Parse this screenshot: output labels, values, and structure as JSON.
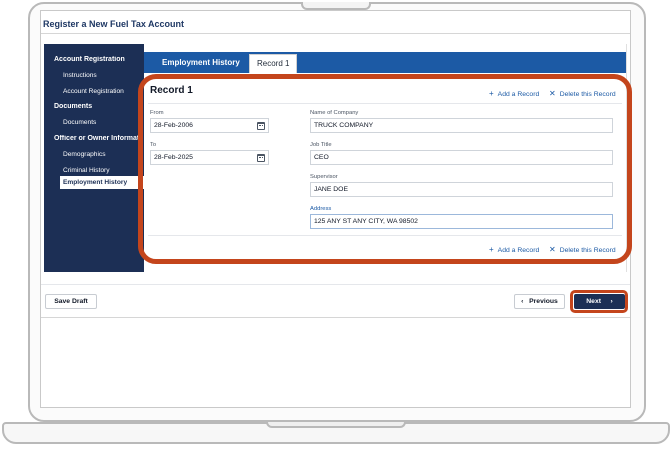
{
  "page": {
    "title": "Register a New Fuel Tax Account"
  },
  "sidebar": {
    "items": [
      {
        "label": "Account Registration",
        "kind": "section"
      },
      {
        "label": "Instructions",
        "kind": "sub"
      },
      {
        "label": "Account Registration",
        "kind": "sub"
      },
      {
        "label": "Documents",
        "kind": "section"
      },
      {
        "label": "Documents",
        "kind": "sub"
      },
      {
        "label": "Officer or Owner Informat",
        "kind": "section"
      },
      {
        "label": "Demographics",
        "kind": "sub"
      },
      {
        "label": "Criminal History",
        "kind": "sub"
      },
      {
        "label": "Employment History",
        "kind": "sub",
        "active": true
      }
    ]
  },
  "tabs": [
    {
      "label": "Employment History",
      "active": false
    },
    {
      "label": "Record 1",
      "active": true
    }
  ],
  "record": {
    "title": "Record 1",
    "add_label": "Add a Record",
    "delete_label": "Delete this Record",
    "add_icon": "plus-icon",
    "delete_icon": "close-icon",
    "from_label": "From",
    "from_value": "28-Feb-2006",
    "to_label": "To",
    "to_value": "28-Feb-2025",
    "company_label": "Name of Company",
    "company_value": "TRUCK COMPANY",
    "job_label": "Job Title",
    "job_value": "CEO",
    "supervisor_label": "Supervisor",
    "supervisor_value": "JANE DOE",
    "address_label": "Address",
    "address_value": "125 ANY ST ANY CITY, WA 98502"
  },
  "footer": {
    "save_draft_label": "Save Draft",
    "previous_label": "Previous",
    "next_label": "Next",
    "prev_chevron": "‹",
    "next_chevron": "›"
  },
  "colors": {
    "navy": "#1c2f55",
    "tab_blue": "#1c5aa5",
    "highlight_orange": "#c4451c"
  }
}
